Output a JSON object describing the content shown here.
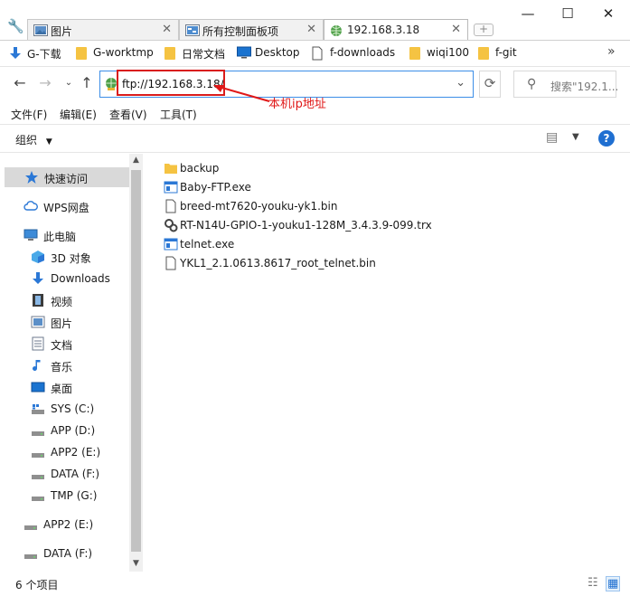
{
  "tabs": [
    {
      "label": "图片",
      "icon": "pictures-folder-icon",
      "closable": true
    },
    {
      "label": "所有控制面板项",
      "icon": "control-panel-icon",
      "closable": true
    },
    {
      "label": "192.168.3.18",
      "icon": "ftp-globe-icon",
      "closable": true,
      "active": true
    }
  ],
  "window_controls": {
    "minimize": "—",
    "maximize": "☐",
    "close": "✕"
  },
  "bookmarks": [
    {
      "label": "G-下载",
      "icon": "download-arrow-icon"
    },
    {
      "label": "G-worktmp",
      "icon": "folder-icon"
    },
    {
      "label": "日常文档",
      "icon": "folder-icon"
    },
    {
      "label": "Desktop",
      "icon": "desktop-icon"
    },
    {
      "label": "f-downloads",
      "icon": "document-icon"
    },
    {
      "label": "wiqi100",
      "icon": "folder-icon"
    },
    {
      "label": "f-git",
      "icon": "folder-icon"
    }
  ],
  "address": {
    "value": "ftp://192.168.3.18/",
    "annotation": "本机ip地址"
  },
  "search": {
    "placeholder": "搜索\"192.1..."
  },
  "menu": [
    {
      "label": "文件(F)"
    },
    {
      "label": "编辑(E)"
    },
    {
      "label": "查看(V)"
    },
    {
      "label": "工具(T)"
    }
  ],
  "command_bar": {
    "organize_label": "组织"
  },
  "nav_pane": [
    {
      "label": "快速访问",
      "icon": "star-icon",
      "selected": true
    },
    {
      "label": "WPS网盘",
      "icon": "cloud-icon"
    },
    {
      "label": "此电脑",
      "icon": "computer-icon"
    },
    {
      "label": "3D 对象",
      "icon": "cube-3d-icon"
    },
    {
      "label": "Downloads",
      "icon": "download-arrow-icon"
    },
    {
      "label": "视频",
      "icon": "video-icon"
    },
    {
      "label": "图片",
      "icon": "pictures-icon"
    },
    {
      "label": "文档",
      "icon": "document-icon"
    },
    {
      "label": "音乐",
      "icon": "music-note-icon"
    },
    {
      "label": "桌面",
      "icon": "desktop-icon"
    },
    {
      "label": "SYS (C:)",
      "icon": "system-drive-icon"
    },
    {
      "label": "APP (D:)",
      "icon": "drive-icon"
    },
    {
      "label": "APP2 (E:)",
      "icon": "drive-icon"
    },
    {
      "label": "DATA (F:)",
      "icon": "drive-icon"
    },
    {
      "label": "TMP (G:)",
      "icon": "drive-icon"
    },
    {
      "label": "APP2 (E:)",
      "icon": "drive-icon"
    },
    {
      "label": "DATA (F:)",
      "icon": "drive-icon"
    }
  ],
  "files": [
    {
      "name": "backup",
      "icon": "folder-icon"
    },
    {
      "name": "Baby-FTP.exe",
      "icon": "exe-icon"
    },
    {
      "name": "breed-mt7620-youku-yk1.bin",
      "icon": "file-icon"
    },
    {
      "name": "RT-N14U-GPIO-1-youku1-128M_3.4.3.9-099.trx",
      "icon": "settings-file-icon"
    },
    {
      "name": "telnet.exe",
      "icon": "exe-icon"
    },
    {
      "name": "YKL1_2.1.0613.8617_root_telnet.bin",
      "icon": "file-icon"
    }
  ],
  "status": {
    "item_count": "6 个项目"
  },
  "colors": {
    "accent": "#3c8ee7",
    "annotation_red": "#e01818",
    "help_blue": "#1f6fd1",
    "folder_yellow": "#f5c342"
  }
}
